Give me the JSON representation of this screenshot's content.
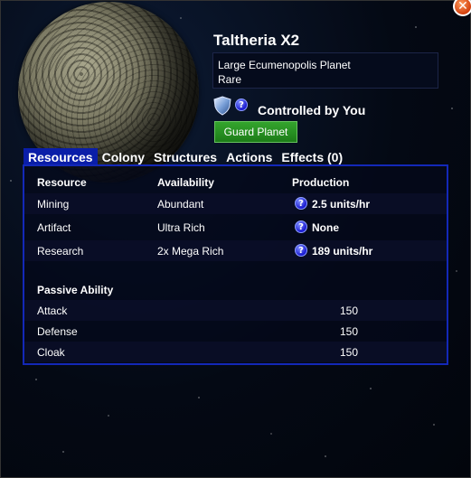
{
  "planet": {
    "name": "Taltheria X2",
    "type_line": "Large Ecumenopolis Planet",
    "rarity": "Rare",
    "controlled_text": "Controlled by You",
    "guard_label": "Guard Planet"
  },
  "tabs": [
    {
      "label": "Resources",
      "active": true
    },
    {
      "label": "Colony"
    },
    {
      "label": "Structures"
    },
    {
      "label": "Actions"
    },
    {
      "label": "Effects (0)"
    }
  ],
  "resources": {
    "headers": [
      "Resource",
      "Availability",
      "Production"
    ],
    "rows": [
      {
        "resource": "Mining",
        "availability": "Abundant",
        "production": "2.5 units/hr"
      },
      {
        "resource": "Artifact",
        "availability": "Ultra Rich",
        "production": "None"
      },
      {
        "resource": "Research",
        "availability": "2x Mega Rich",
        "production": "189 units/hr"
      }
    ]
  },
  "passive": {
    "header": "Passive Ability",
    "rows": [
      {
        "label": "Attack",
        "value": "150"
      },
      {
        "label": "Defense",
        "value": "150"
      },
      {
        "label": "Cloak",
        "value": "150"
      }
    ]
  },
  "icons": {
    "close": "close-icon",
    "shield": "shield-icon",
    "help": "help-icon"
  },
  "colors": {
    "tab_active": "#0a1ea8",
    "panel_border": "#1328b8",
    "guard_button": "#1c7c18"
  }
}
